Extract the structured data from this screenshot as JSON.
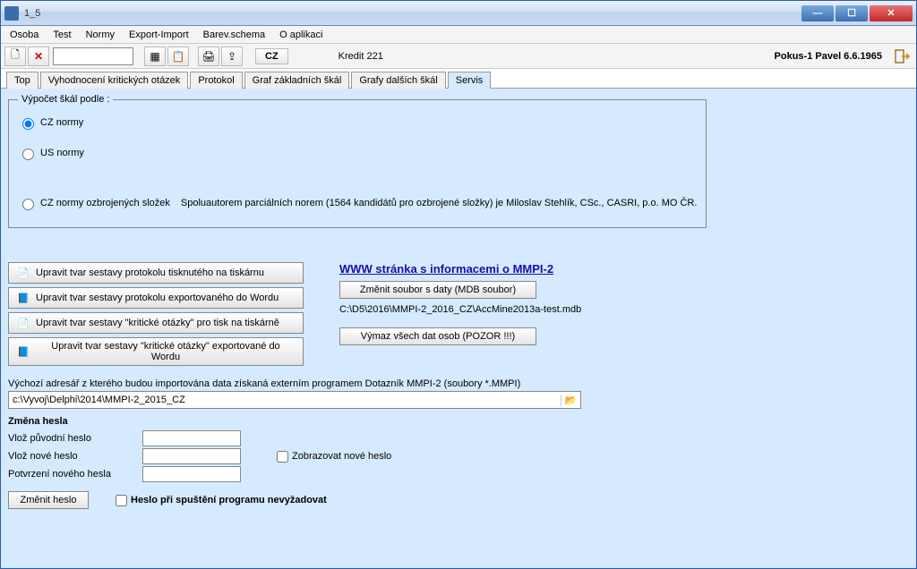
{
  "window": {
    "title": "1_5"
  },
  "menu": {
    "osoba": "Osoba",
    "test": "Test",
    "normy": "Normy",
    "export_import": "Export-Import",
    "barev_schema": "Barev.schema",
    "o_aplikaci": "O aplikaci"
  },
  "toolbar": {
    "cz": "CZ",
    "kredit": "Kredit 221",
    "user": "Pokus-1 Pavel   6.6.1965"
  },
  "tabs": {
    "top": "Top",
    "vyhodnoceni": "Vyhodnocení kritických otázek",
    "protokol": "Protokol",
    "graf_zakl": "Graf základních škál",
    "graf_dalsi": "Grafy dalších škál",
    "servis": "Servis"
  },
  "calc_group": {
    "legend": "Výpočet škál podle :",
    "cz": "CZ normy",
    "us": "US normy",
    "cz_oz": "CZ normy ozbrojených složek",
    "note": "Spoluautorem parciálních norem (1564 kandidátů pro ozbrojené složky) je Miloslav Stehlík, CSc., CASRI, p.o. MO ČR."
  },
  "edit_buttons": {
    "b1": "Upravit tvar sestavy protokolu tisknutého na tiskárnu",
    "b2": "Upravit tvar sestavy protokolu exportovaného do Wordu",
    "b3": "Upravit tvar sestavy \"kritické otázky\" pro tisk na tiskárně",
    "b4": "Upravit tvar sestavy \"kritické otázky\" exportované do Wordu"
  },
  "rightcol": {
    "link": "WWW stránka s informacemi o  MMPI-2",
    "change_file": "Změnit soubor s daty (MDB soubor)",
    "path": "C:\\D5\\2016\\MMPI-2_2016_CZ\\AccMine2013a-test.mdb",
    "wipe": "Výmaz všech dat osob (POZOR !!!)"
  },
  "import": {
    "label": "Výchozí adresář z kterého budou importována data získaná externím programem Dotazník MMPI-2 (soubory *.MMPI)",
    "path": "c:\\Vyvoj\\Delphi\\2014\\MMPI-2_2015_CZ"
  },
  "pw": {
    "hdr": "Změna hesla",
    "orig": "Vlož původní heslo",
    "new": "Vlož nové heslo",
    "confirm": "Potvrzení nového hesla",
    "show": "Zobrazovat nové heslo",
    "change_btn": "Změnit heslo",
    "no_require": "Heslo při spuštění programu nevyžadovat"
  }
}
